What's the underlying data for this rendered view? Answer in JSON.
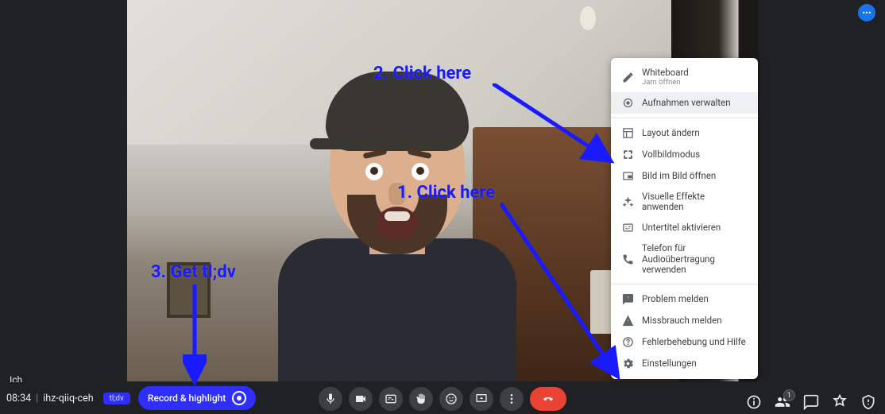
{
  "meeting": {
    "time": "08:34",
    "code": "ihz-qiiq-ceh",
    "self_label": "Ich"
  },
  "tldv": {
    "pill_label": "tl;dv",
    "button_label": "Record & highlight"
  },
  "participants": {
    "count": "1"
  },
  "annotations": {
    "step1": "1. Click here",
    "step2": "2. Click here",
    "step3": "3. Get tl;dv"
  },
  "menu": {
    "whiteboard_label": "Whiteboard",
    "whiteboard_sub": "Jam öffnen",
    "recordings_label": "Aufnahmen verwalten",
    "layout_label": "Layout ändern",
    "fullscreen_label": "Vollbildmodus",
    "pip_label": "Bild im Bild öffnen",
    "effects_label": "Visuelle Effekte anwenden",
    "captions_label": "Untertitel aktivieren",
    "phone_label": "Telefon für Audioübertragung verwenden",
    "report_problem_label": "Problem melden",
    "report_abuse_label": "Missbrauch melden",
    "help_label": "Fehlerbehebung und Hilfe",
    "settings_label": "Einstellungen"
  }
}
